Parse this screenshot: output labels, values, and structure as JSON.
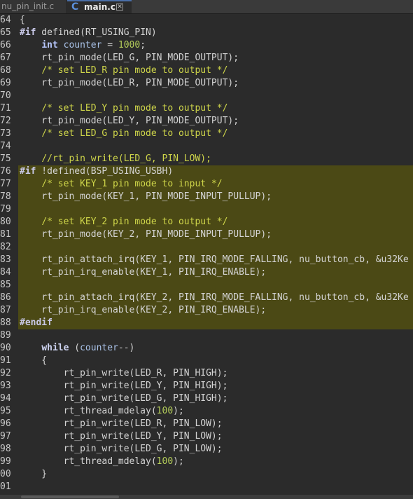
{
  "tabs": [
    {
      "label": "nu_pin_init.c",
      "active": false
    },
    {
      "label": "main.c",
      "active": true
    }
  ],
  "active_tab_icon": "c-language-icon",
  "colors": {
    "background": "#2b2b2b",
    "highlight": "#4b4915",
    "comment": "#cfd64a",
    "number": "#b5ce5a",
    "keyword": "#cdd3f0",
    "variable": "#a9c2e8"
  },
  "lines": [
    {
      "num": "64",
      "hl": false,
      "tokens": [
        {
          "t": "{",
          "c": ""
        }
      ]
    },
    {
      "num": "65",
      "hl": false,
      "tokens": [
        {
          "t": "#if",
          "c": "pp"
        },
        {
          "t": " defined(RT_USING_PIN)",
          "c": ""
        }
      ]
    },
    {
      "num": "66",
      "hl": false,
      "tokens": [
        {
          "t": "    ",
          "c": ""
        },
        {
          "t": "int",
          "c": "type"
        },
        {
          "t": " ",
          "c": ""
        },
        {
          "t": "counter",
          "c": "var"
        },
        {
          "t": " = ",
          "c": ""
        },
        {
          "t": "1000",
          "c": "num"
        },
        {
          "t": ";",
          "c": ""
        }
      ]
    },
    {
      "num": "67",
      "hl": false,
      "tokens": [
        {
          "t": "    rt_pin_mode(LED_G, PIN_MODE_OUTPUT);",
          "c": ""
        }
      ]
    },
    {
      "num": "68",
      "hl": false,
      "tokens": [
        {
          "t": "    ",
          "c": ""
        },
        {
          "t": "/* set LED_R pin mode to output */",
          "c": "cm"
        }
      ]
    },
    {
      "num": "69",
      "hl": false,
      "tokens": [
        {
          "t": "    rt_pin_mode(LED_R, PIN_MODE_OUTPUT);",
          "c": ""
        }
      ]
    },
    {
      "num": "70",
      "hl": false,
      "tokens": [
        {
          "t": "",
          "c": ""
        }
      ]
    },
    {
      "num": "71",
      "hl": false,
      "tokens": [
        {
          "t": "    ",
          "c": ""
        },
        {
          "t": "/* set LED_Y pin mode to output */",
          "c": "cm"
        }
      ]
    },
    {
      "num": "72",
      "hl": false,
      "tokens": [
        {
          "t": "    rt_pin_mode(LED_Y, PIN_MODE_OUTPUT);",
          "c": ""
        }
      ]
    },
    {
      "num": "73",
      "hl": false,
      "tokens": [
        {
          "t": "    ",
          "c": ""
        },
        {
          "t": "/* set LED_G pin mode to output */",
          "c": "cm"
        }
      ]
    },
    {
      "num": "74",
      "hl": false,
      "tokens": [
        {
          "t": "",
          "c": ""
        }
      ]
    },
    {
      "num": "75",
      "hl": false,
      "tokens": [
        {
          "t": "    ",
          "c": ""
        },
        {
          "t": "//rt_pin_write(LED_G, PIN_LOW);",
          "c": "cm"
        }
      ]
    },
    {
      "num": "76",
      "hl": true,
      "tokens": [
        {
          "t": "#if",
          "c": "pp"
        },
        {
          "t": " !defined(BSP_USING_USBH)",
          "c": ""
        }
      ]
    },
    {
      "num": "77",
      "hl": true,
      "tokens": [
        {
          "t": "    ",
          "c": ""
        },
        {
          "t": "/* set KEY_1 pin mode to input */",
          "c": "cm"
        }
      ]
    },
    {
      "num": "78",
      "hl": true,
      "tokens": [
        {
          "t": "    rt_pin_mode(KEY_1, PIN_MODE_INPUT_PULLUP);",
          "c": ""
        }
      ]
    },
    {
      "num": "79",
      "hl": true,
      "tokens": [
        {
          "t": "",
          "c": ""
        }
      ]
    },
    {
      "num": "80",
      "hl": true,
      "tokens": [
        {
          "t": "    ",
          "c": ""
        },
        {
          "t": "/* set KEY_2 pin mode to output */",
          "c": "cm"
        }
      ]
    },
    {
      "num": "81",
      "hl": true,
      "tokens": [
        {
          "t": "    rt_pin_mode(KEY_2, PIN_MODE_INPUT_PULLUP);",
          "c": ""
        }
      ]
    },
    {
      "num": "82",
      "hl": true,
      "tokens": [
        {
          "t": "",
          "c": ""
        }
      ]
    },
    {
      "num": "83",
      "hl": true,
      "tokens": [
        {
          "t": "    rt_pin_attach_irq(KEY_1, PIN_IRQ_MODE_FALLING, nu_button_cb, &u32Ke",
          "c": ""
        }
      ]
    },
    {
      "num": "84",
      "hl": true,
      "tokens": [
        {
          "t": "    rt_pin_irq_enable(KEY_1, PIN_IRQ_ENABLE);",
          "c": ""
        }
      ]
    },
    {
      "num": "85",
      "hl": true,
      "tokens": [
        {
          "t": "",
          "c": ""
        }
      ]
    },
    {
      "num": "86",
      "hl": true,
      "tokens": [
        {
          "t": "    rt_pin_attach_irq(KEY_2, PIN_IRQ_MODE_FALLING, nu_button_cb, &u32Ke",
          "c": ""
        }
      ]
    },
    {
      "num": "87",
      "hl": true,
      "tokens": [
        {
          "t": "    rt_pin_irq_enable(KEY_2, PIN_IRQ_ENABLE);",
          "c": ""
        }
      ]
    },
    {
      "num": "88",
      "hl": true,
      "tokens": [
        {
          "t": "#endif",
          "c": "pp"
        }
      ]
    },
    {
      "num": "89",
      "hl": false,
      "tokens": [
        {
          "t": "",
          "c": ""
        }
      ]
    },
    {
      "num": "90",
      "hl": false,
      "tokens": [
        {
          "t": "    ",
          "c": ""
        },
        {
          "t": "while",
          "c": "kw"
        },
        {
          "t": " (",
          "c": ""
        },
        {
          "t": "counter",
          "c": "var"
        },
        {
          "t": "--)",
          "c": ""
        }
      ]
    },
    {
      "num": "91",
      "hl": false,
      "tokens": [
        {
          "t": "    {",
          "c": ""
        }
      ]
    },
    {
      "num": "92",
      "hl": false,
      "tokens": [
        {
          "t": "        rt_pin_write(LED_R, PIN_HIGH);",
          "c": ""
        }
      ]
    },
    {
      "num": "93",
      "hl": false,
      "tokens": [
        {
          "t": "        rt_pin_write(LED_Y, PIN_HIGH);",
          "c": ""
        }
      ]
    },
    {
      "num": "94",
      "hl": false,
      "tokens": [
        {
          "t": "        rt_pin_write(LED_G, PIN_HIGH);",
          "c": ""
        }
      ]
    },
    {
      "num": "95",
      "hl": false,
      "tokens": [
        {
          "t": "        rt_thread_mdelay(",
          "c": ""
        },
        {
          "t": "100",
          "c": "num"
        },
        {
          "t": ");",
          "c": ""
        }
      ]
    },
    {
      "num": "96",
      "hl": false,
      "tokens": [
        {
          "t": "        rt_pin_write(LED_R, PIN_LOW);",
          "c": ""
        }
      ]
    },
    {
      "num": "97",
      "hl": false,
      "tokens": [
        {
          "t": "        rt_pin_write(LED_Y, PIN_LOW);",
          "c": ""
        }
      ]
    },
    {
      "num": "98",
      "hl": false,
      "tokens": [
        {
          "t": "        rt_pin_write(LED_G, PIN_LOW);",
          "c": ""
        }
      ]
    },
    {
      "num": "99",
      "hl": false,
      "tokens": [
        {
          "t": "        rt_thread_mdelay(",
          "c": ""
        },
        {
          "t": "100",
          "c": "num"
        },
        {
          "t": ");",
          "c": ""
        }
      ]
    },
    {
      "num": "00",
      "hl": false,
      "tokens": [
        {
          "t": "    }",
          "c": ""
        }
      ]
    },
    {
      "num": "01",
      "hl": false,
      "tokens": [
        {
          "t": "",
          "c": ""
        }
      ]
    }
  ]
}
